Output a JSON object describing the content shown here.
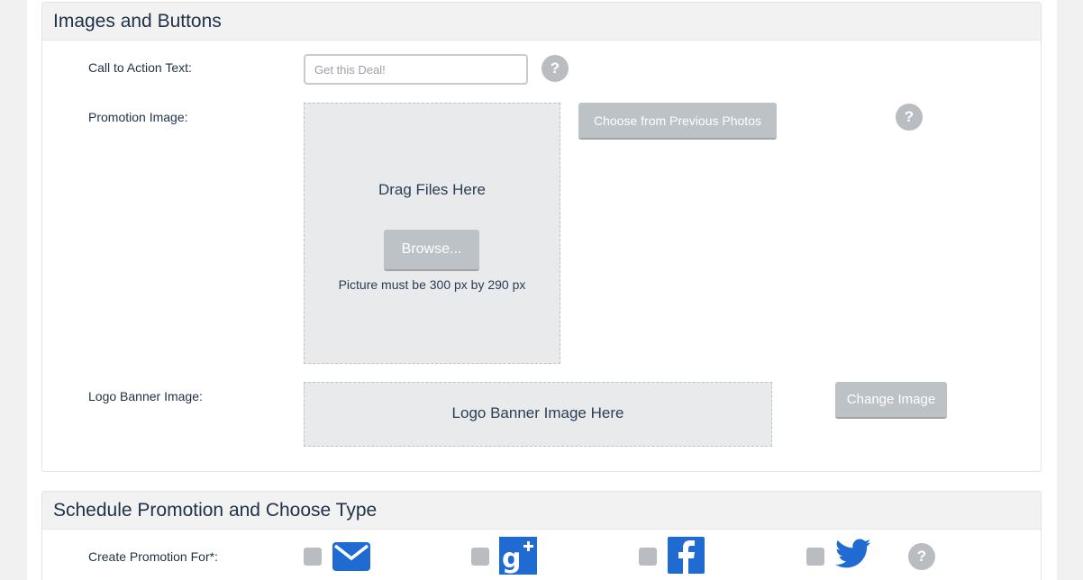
{
  "images_section": {
    "title": "Images and Buttons",
    "cta_label": "Call to Action Text:",
    "cta_placeholder": "Get this Deal!",
    "promo_label": "Promotion Image:",
    "choose_previous_label": "Choose from Previous Photos",
    "drag_text": "Drag Files Here",
    "browse_label": "Browse...",
    "picture_note": "Picture must be 300 px by 290 px",
    "logo_label": "Logo Banner Image:",
    "logo_placeholder_text": "Logo Banner Image Here",
    "change_image_label": "Change Image",
    "help_glyph": "?"
  },
  "schedule_section": {
    "title": "Schedule Promotion and Choose Type",
    "create_for_label": "Create Promotion For*:",
    "channels": [
      {
        "name": "email",
        "icon": "envelope-icon",
        "color": "#1f6bd1"
      },
      {
        "name": "google-plus",
        "icon": "google-plus-icon",
        "color": "#1f6bd1"
      },
      {
        "name": "facebook",
        "icon": "facebook-icon",
        "color": "#1f6bd1"
      },
      {
        "name": "twitter",
        "icon": "twitter-icon",
        "color": "#1f6bd1"
      }
    ]
  },
  "colors": {
    "accent_blue": "#1f6bd1",
    "button_gray": "#bcc2c6",
    "panel_header": "#f2f2f3"
  }
}
